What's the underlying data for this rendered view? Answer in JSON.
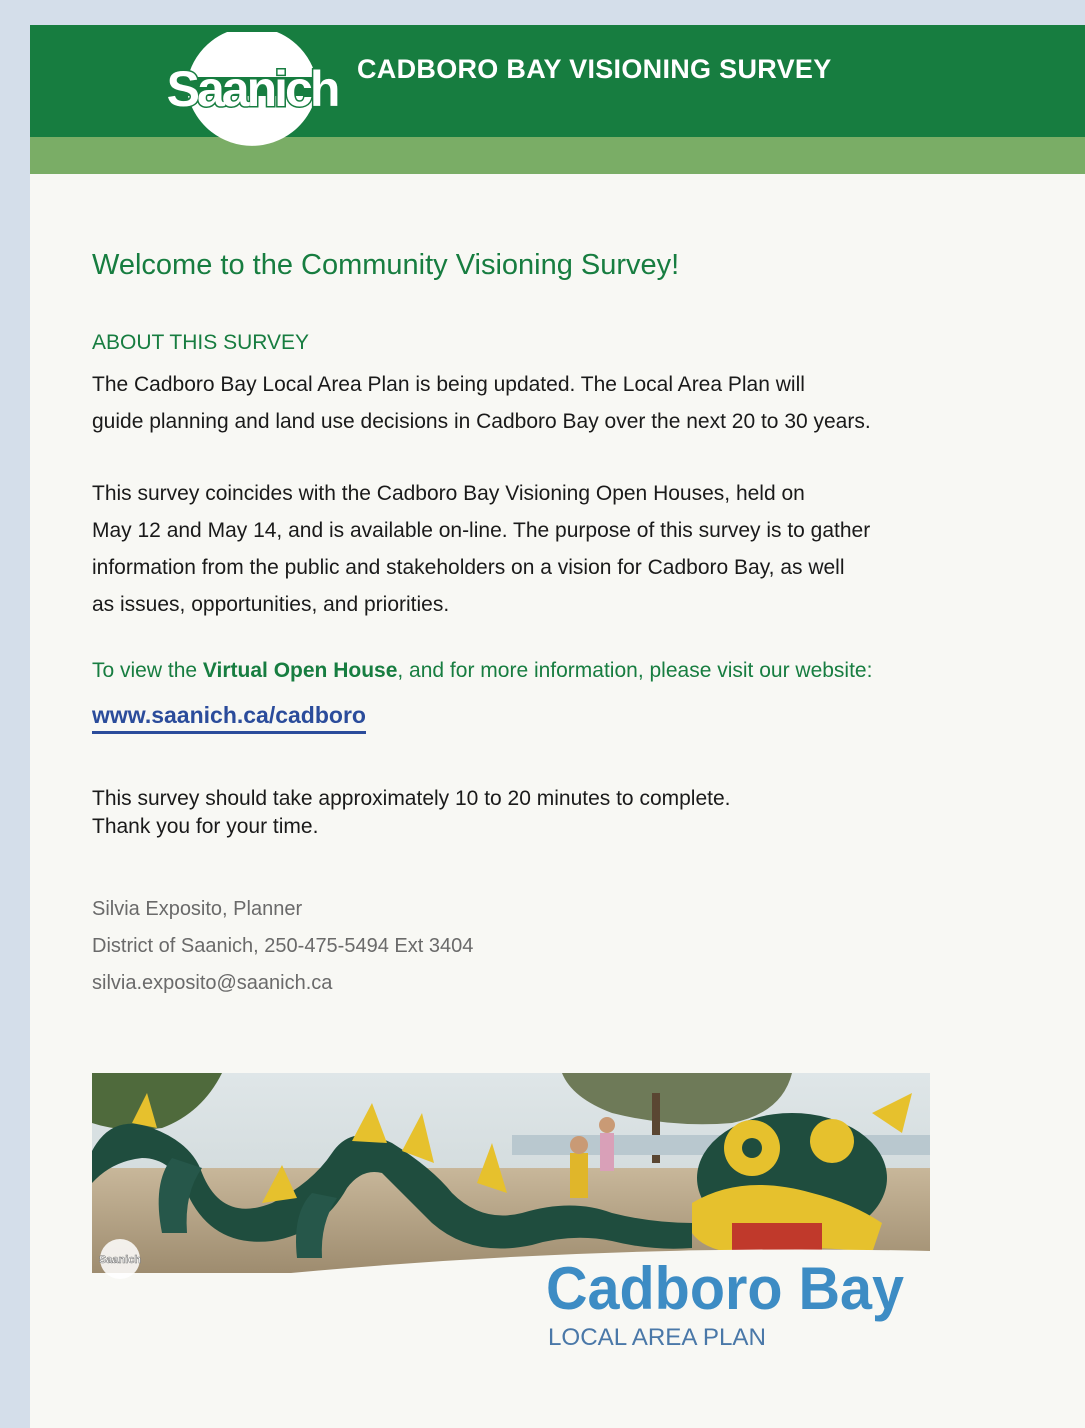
{
  "header": {
    "logo_text": "Saanich",
    "title": "CADBORO BAY VISIONING SURVEY",
    "colors": {
      "primary": "#177d40",
      "stripe": "#7aad66"
    }
  },
  "welcome": {
    "heading": "Welcome to the Community Visioning Survey!",
    "about_heading": "ABOUT THIS SURVEY",
    "paragraph1": [
      "The Cadboro Bay Local Area Plan is being updated. The Local Area Plan will",
      "guide planning and land use decisions in Cadboro Bay over the next 20 to 30 years."
    ],
    "paragraph2": [
      "This survey coincides with the Cadboro Bay Visioning Open Houses, held on",
      "May 12 and May 14, and is available on-line. The purpose of this survey is to gather",
      "information from the public and stakeholders on a vision for Cadboro Bay, as well",
      "as issues, opportunities, and priorities."
    ],
    "visit_prefix": "To view the ",
    "visit_bold": "Virtual Open House",
    "visit_suffix": ", and for more information, please visit our website:",
    "link_text": "www.saanich.ca/cadboro",
    "timing": [
      "This survey should take approximately 10 to 20 minutes to complete.",
      "Thank you for your time."
    ]
  },
  "contact": {
    "name": "Silvia Exposito, Planner",
    "org_phone": "District of Saanich, 250-475-5494 Ext 3404",
    "email": "silvia.exposito@saanich.ca"
  },
  "banner": {
    "logo_text": "Saanich",
    "title": "Cadboro Bay",
    "subtitle": "LOCAL AREA PLAN",
    "colors": {
      "title": "#3d8cc4"
    }
  }
}
